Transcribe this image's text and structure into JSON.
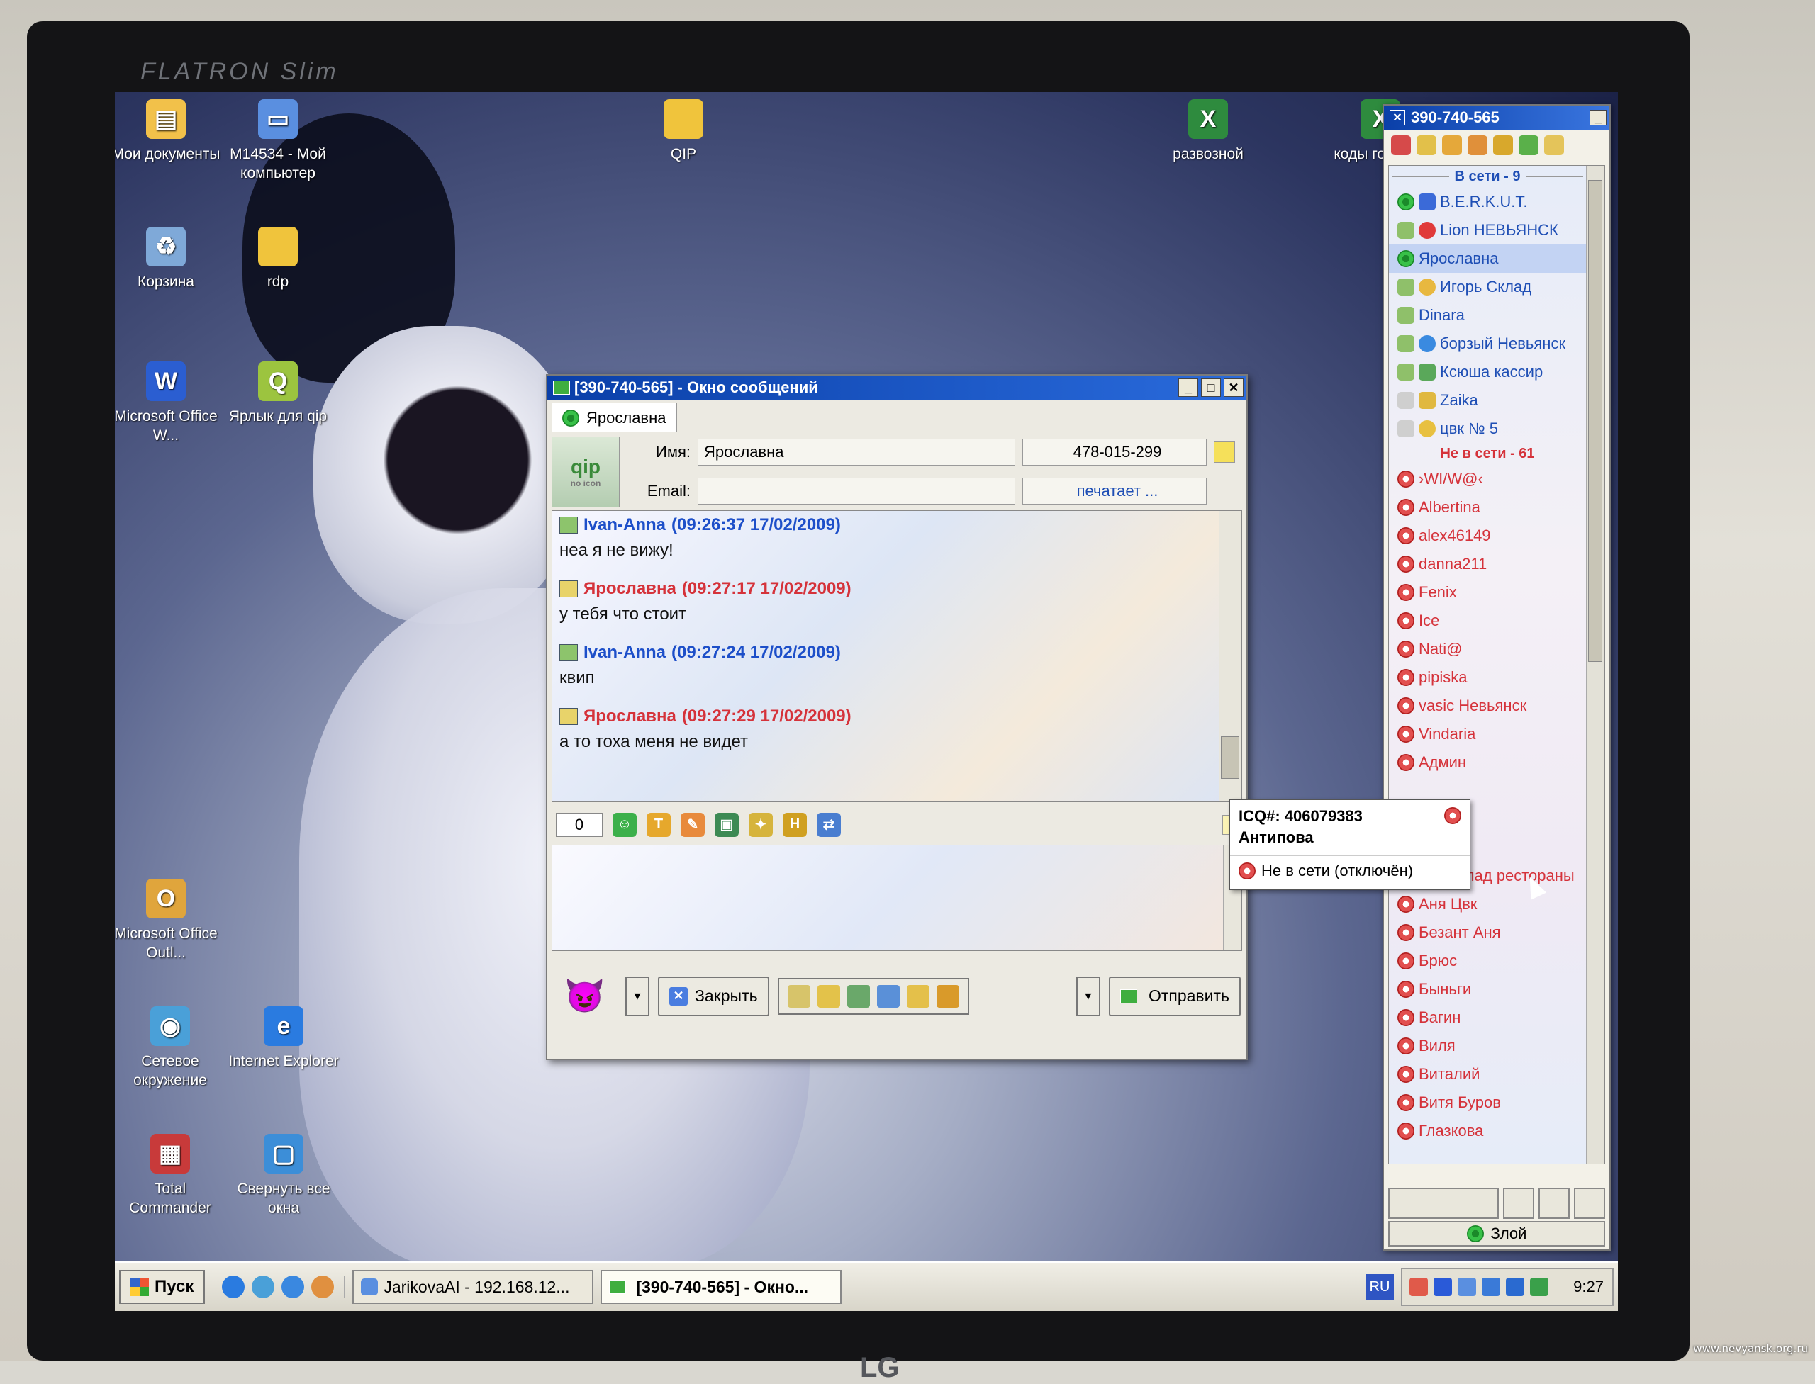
{
  "monitor": {
    "brand_top": "FLATRON Slim",
    "brand_bottom": "LG",
    "watermark": "www.nevyansk.org.ru"
  },
  "desktop_icons": [
    {
      "label": "Мои документы",
      "icon": "my-documents-icon"
    },
    {
      "label": "M14534 - Мой компьютер",
      "icon": "my-computer-icon"
    },
    {
      "label": "QIP",
      "icon": "folder-icon"
    },
    {
      "label": "развозной",
      "icon": "excel-file-icon"
    },
    {
      "label": "коды готовые",
      "icon": "excel-file-icon"
    },
    {
      "label": "Корзина",
      "icon": "recycle-bin-icon"
    },
    {
      "label": "rdp",
      "icon": "folder-shortcut-icon"
    },
    {
      "label": "Microsoft Office W...",
      "icon": "word-icon"
    },
    {
      "label": "Ярлык для qip",
      "icon": "qip-shortcut-icon"
    },
    {
      "label": "Microsoft Office Outl...",
      "icon": "outlook-icon"
    },
    {
      "label": "Сетевое окружение",
      "icon": "network-icon"
    },
    {
      "label": "Internet Explorer",
      "icon": "ie-icon"
    },
    {
      "label": "Total Commander",
      "icon": "total-commander-icon"
    },
    {
      "label": "Свернуть все окна",
      "icon": "minimize-all-icon"
    }
  ],
  "message_window": {
    "title": "[390-740-565] - Окно сообщений",
    "tab_label": "Ярославна",
    "name_label": "Имя:",
    "name_value": "Ярославна",
    "uin_value": "478-015-299",
    "email_label": "Email:",
    "email_value": "",
    "typing_status": "печатает ...",
    "logo_text": "qip",
    "logo_sub": "no icon",
    "messages": [
      {
        "author": "Ivan-Anna",
        "time": "(09:26:37 17/02/2009)",
        "text": "неа я не вижу!",
        "side": "self"
      },
      {
        "author": "Ярославна",
        "time": "(09:27:17 17/02/2009)",
        "text": "у тебя что стоит",
        "side": "contact"
      },
      {
        "author": "Ivan-Anna",
        "time": "(09:27:24 17/02/2009)",
        "text": "квип",
        "side": "self"
      },
      {
        "author": "Ярославна",
        "time": "(09:27:29 17/02/2009)",
        "text": "а то тоха меня не видет",
        "side": "contact"
      }
    ],
    "char_counter": "0",
    "input_value": "",
    "close_label": "Закрыть",
    "send_label": "Отправить"
  },
  "contact_list": {
    "title": "390-740-565",
    "online_header": "В сети - 9",
    "offline_header": "Не в сети - 61",
    "online": [
      "B.E.R.K.U.T.",
      "Lion НЕВЬЯНСК",
      "Ярославна",
      "Игорь Склад",
      "Dinara",
      "борзый Невьянск",
      "Ксюша кассир",
      "Zaika",
      "цвк № 5"
    ],
    "offline": [
      "›WI/W@‹",
      "Albertina",
      "alex46149",
      "danna211",
      "Fenix",
      "Ice",
      "Nati@",
      "pipiska",
      "vasic Невьянск",
      "Vindaria",
      "Админ",
      "Аня склад рестораны",
      "Аня Цвк",
      "Безант Аня",
      "Брюс",
      "Быньги",
      "Вагин",
      "Виля",
      "Виталий",
      "Витя Буров",
      "Глазкова"
    ],
    "status_label": "Злой"
  },
  "tooltip": {
    "uin": "ICQ#: 406079383",
    "name": "Антипова",
    "status": "Не в сети (отключён)"
  },
  "taskbar": {
    "start_label": "Пуск",
    "tasks": [
      "JarikovaAI - 192.168.12...",
      "[390-740-565] - Окно..."
    ],
    "lang": "RU",
    "clock": "9:27"
  }
}
